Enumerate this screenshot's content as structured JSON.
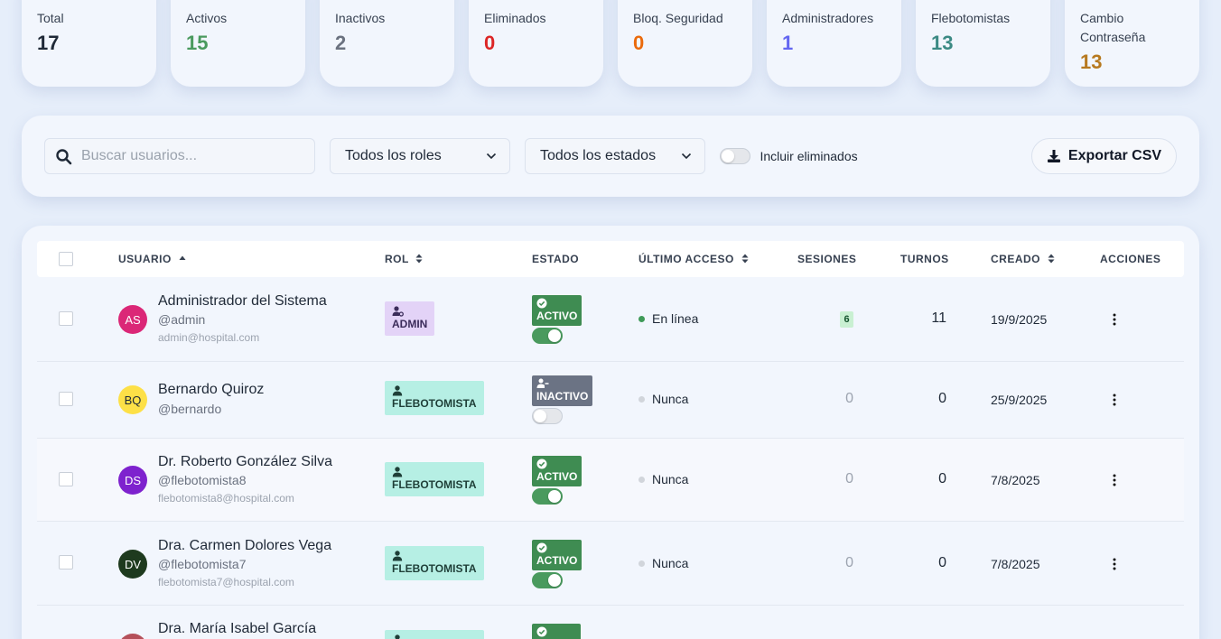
{
  "stats": [
    {
      "label": "Total",
      "value": "17",
      "color": "#1f2937"
    },
    {
      "label": "Activos",
      "value": "15",
      "color": "#4a9a5e"
    },
    {
      "label": "Inactivos",
      "value": "2",
      "color": "#6b7280"
    },
    {
      "label": "Eliminados",
      "value": "0",
      "color": "#dc2626"
    },
    {
      "label": "Bloq. Seguridad",
      "value": "0",
      "color": "#ea6a0c"
    },
    {
      "label": "Administradores",
      "value": "1",
      "color": "#6366f1"
    },
    {
      "label": "Flebotomistas",
      "value": "13",
      "color": "#3b8a84"
    },
    {
      "label": "Cambio Contraseña",
      "value": "13",
      "color": "#b7791f"
    }
  ],
  "filters": {
    "search_placeholder": "Buscar usuarios...",
    "role_select": "Todos los roles",
    "status_select": "Todos los estados",
    "include_deleted_label": "Incluir eliminados",
    "include_deleted": false,
    "export_label": "Exportar CSV"
  },
  "table": {
    "headers": {
      "usuario": "USUARIO",
      "rol": "ROL",
      "estado": "ESTADO",
      "ultimo_acceso": "ÚLTIMO ACCESO",
      "sesiones": "SESIONES",
      "turnos": "TURNOS",
      "creado": "CREADO",
      "acciones": "ACCIONES"
    },
    "rows": [
      {
        "initials": "AS",
        "avatar_color": "#db2777",
        "name": "Administrador del Sistema",
        "handle": "@admin",
        "email": "admin@hospital.com",
        "role": "ADMIN",
        "status": "ACTIVO",
        "active": true,
        "access": "En línea",
        "online": true,
        "sessions": "6",
        "turnos": "11",
        "created": "19/9/2025"
      },
      {
        "initials": "BQ",
        "avatar_color": "#fde047",
        "name": "Bernardo Quiroz",
        "handle": "@bernardo",
        "email": "",
        "role": "FLEBOTOMISTA",
        "status": "INACTIVO",
        "active": false,
        "access": "Nunca",
        "online": false,
        "sessions": "0",
        "turnos": "0",
        "created": "25/9/2025"
      },
      {
        "initials": "DS",
        "avatar_color": "#7e22ce",
        "name": "Dr. Roberto González Silva",
        "handle": "@flebotomista8",
        "email": "flebotomista8@hospital.com",
        "role": "FLEBOTOMISTA",
        "status": "ACTIVO",
        "active": true,
        "access": "Nunca",
        "online": false,
        "sessions": "0",
        "turnos": "0",
        "created": "7/8/2025"
      },
      {
        "initials": "DV",
        "avatar_color": "#1e3a1e",
        "name": "Dra. Carmen Dolores Vega",
        "handle": "@flebotomista7",
        "email": "flebotomista7@hospital.com",
        "role": "FLEBOTOMISTA",
        "status": "ACTIVO",
        "active": true,
        "access": "Nunca",
        "online": false,
        "sessions": "0",
        "turnos": "0",
        "created": "7/8/2025"
      },
      {
        "initials": "",
        "avatar_color": "#b4505a",
        "name": "Dra. María Isabel García",
        "handle": "",
        "email": "",
        "role": "",
        "status": "",
        "active": true,
        "access": "",
        "online": false,
        "sessions": "",
        "turnos": "",
        "created": ""
      }
    ]
  }
}
